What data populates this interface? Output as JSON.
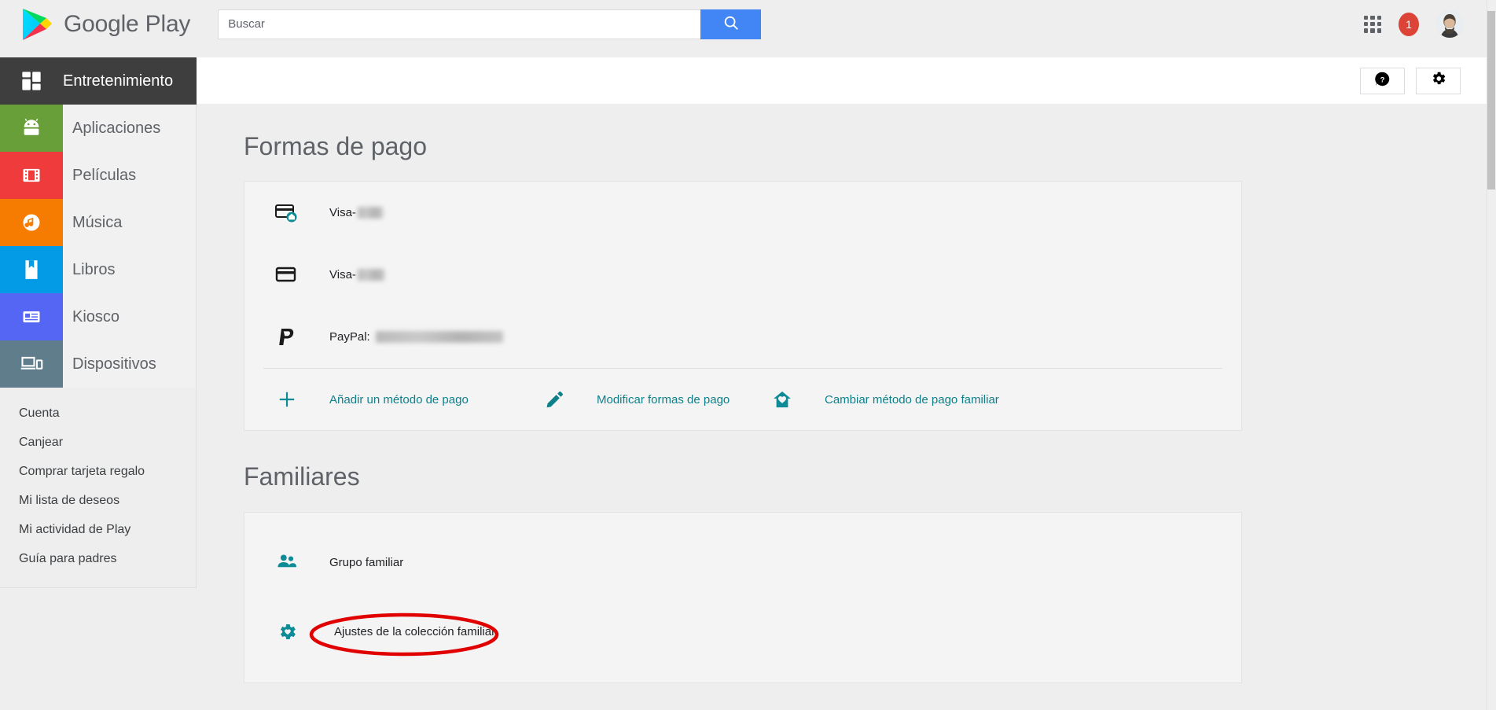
{
  "header": {
    "brand": "Google Play",
    "logo_icon": "google-play-logo",
    "search": {
      "placeholder": "Buscar",
      "value": "",
      "icon": "search-icon",
      "button_color": "#4285f4"
    },
    "apps_icon": "apps-grid-icon",
    "notifications": {
      "count": "1",
      "color": "#db4437"
    },
    "avatar_icon": "user-avatar"
  },
  "sidebar": {
    "header": {
      "label": "Entretenimiento",
      "icon": "dashboard-icon",
      "bg": "#3e3e3e"
    },
    "items": [
      {
        "label": "Aplicaciones",
        "icon": "android-icon",
        "color": "#689f38"
      },
      {
        "label": "Películas",
        "icon": "film-icon",
        "color": "#ef3b3b"
      },
      {
        "label": "Música",
        "icon": "music-note-icon",
        "color": "#f57c00"
      },
      {
        "label": "Libros",
        "icon": "book-icon",
        "color": "#039be5"
      },
      {
        "label": "Kiosco",
        "icon": "newsstand-icon",
        "color": "#5566f5"
      },
      {
        "label": "Dispositivos",
        "icon": "devices-icon",
        "color": "#607d8b"
      }
    ],
    "sub_items": [
      {
        "label": "Cuenta"
      },
      {
        "label": "Canjear"
      },
      {
        "label": "Comprar tarjeta regalo"
      },
      {
        "label": "Mi lista de deseos"
      },
      {
        "label": "Mi actividad de Play"
      },
      {
        "label": "Guía para padres"
      }
    ]
  },
  "content_toolbar": {
    "help_button": {
      "icon": "help-speech-bubble-icon",
      "label": ""
    },
    "settings_button": {
      "icon": "gear-icon",
      "label": ""
    }
  },
  "main": {
    "payments": {
      "title": "Formas de pago",
      "methods": [
        {
          "label": "Visa-",
          "redacted": true,
          "redacted_width": 32,
          "icon": "credit-card-family-icon"
        },
        {
          "label": "Visa-",
          "redacted": true,
          "redacted_width": 34,
          "icon": "credit-card-icon"
        },
        {
          "label": "PayPal:",
          "redacted": true,
          "redacted_width": 162,
          "icon": "paypal-icon"
        }
      ],
      "actions": [
        {
          "label": "Añadir un método de pago",
          "icon": "plus-icon"
        },
        {
          "label": "Modificar formas de pago",
          "icon": "pencil-icon"
        },
        {
          "label": "Cambiar método de pago familiar",
          "icon": "home-family-icon"
        }
      ]
    },
    "family": {
      "title": "Familiares",
      "rows": [
        {
          "label": "Grupo familiar",
          "icon": "people-icon",
          "highlighted": false
        },
        {
          "label": "Ajustes de la colección familiar",
          "icon": "gear-family-icon",
          "highlighted": true
        }
      ],
      "highlight_color": "#e00000"
    }
  },
  "colors": {
    "accent_teal": "#0d7f8a",
    "page_bg": "#eeeeee",
    "card_bg": "#f4f4f4",
    "text_primary": "#202124",
    "text_secondary": "#5f6368"
  }
}
